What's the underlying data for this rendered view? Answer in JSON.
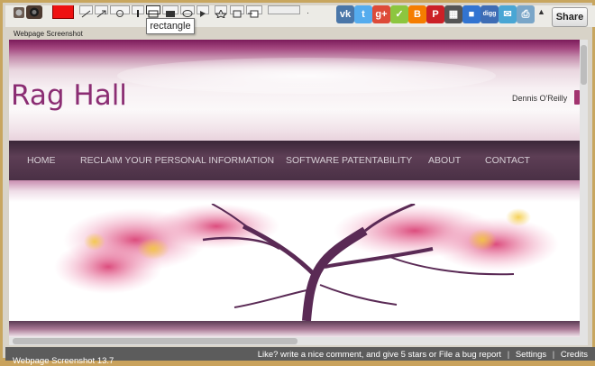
{
  "toolbar": {
    "tooltip": "rectangle",
    "dot": "·",
    "share_label": "Share",
    "more_arrow": "▲",
    "share_services": [
      {
        "name": "vk-icon",
        "glyph": "vk",
        "color": "#4a76a8"
      },
      {
        "name": "twitter-icon",
        "glyph": "t",
        "color": "#55acee"
      },
      {
        "name": "google-plus-icon",
        "glyph": "g+",
        "color": "#dd4b39"
      },
      {
        "name": "yahoo-icon",
        "glyph": "✓",
        "color": "#8cc63f"
      },
      {
        "name": "blogger-icon",
        "glyph": "B",
        "color": "#f57d00"
      },
      {
        "name": "pinterest-icon",
        "glyph": "P",
        "color": "#cb2027"
      },
      {
        "name": "qr-code-icon",
        "glyph": "▦",
        "color": "#555555"
      },
      {
        "name": "delicious-icon",
        "glyph": "■",
        "color": "#3274d1"
      },
      {
        "name": "digg-icon",
        "glyph": "digg",
        "color": "#3e6db5"
      },
      {
        "name": "email-share-icon",
        "glyph": "✉",
        "color": "#49a6d4"
      },
      {
        "name": "print-share-icon",
        "glyph": "⎙",
        "color": "#7aa6c8"
      }
    ]
  },
  "page": {
    "label": "Webpage Screenshot",
    "site_title": "Rag Hall",
    "author": "Dennis O'Reilly",
    "nav": [
      "HOME",
      "RECLAIM YOUR PERSONAL INFORMATION",
      "SOFTWARE PATENTABILITY",
      "ABOUT",
      "CONTACT"
    ]
  },
  "status": {
    "app_name": "Webpage Screenshot 13.7",
    "like_text": "Like? write a nice comment, and give 5 stars",
    "or": "or",
    "bug_report": "File a bug report",
    "settings": "Settings",
    "credits": "Credits",
    "separator": "|"
  },
  "colors": {
    "title": "#8b2d73",
    "nav_bg": "#4a3045",
    "status_bg": "#5c5c5c"
  }
}
